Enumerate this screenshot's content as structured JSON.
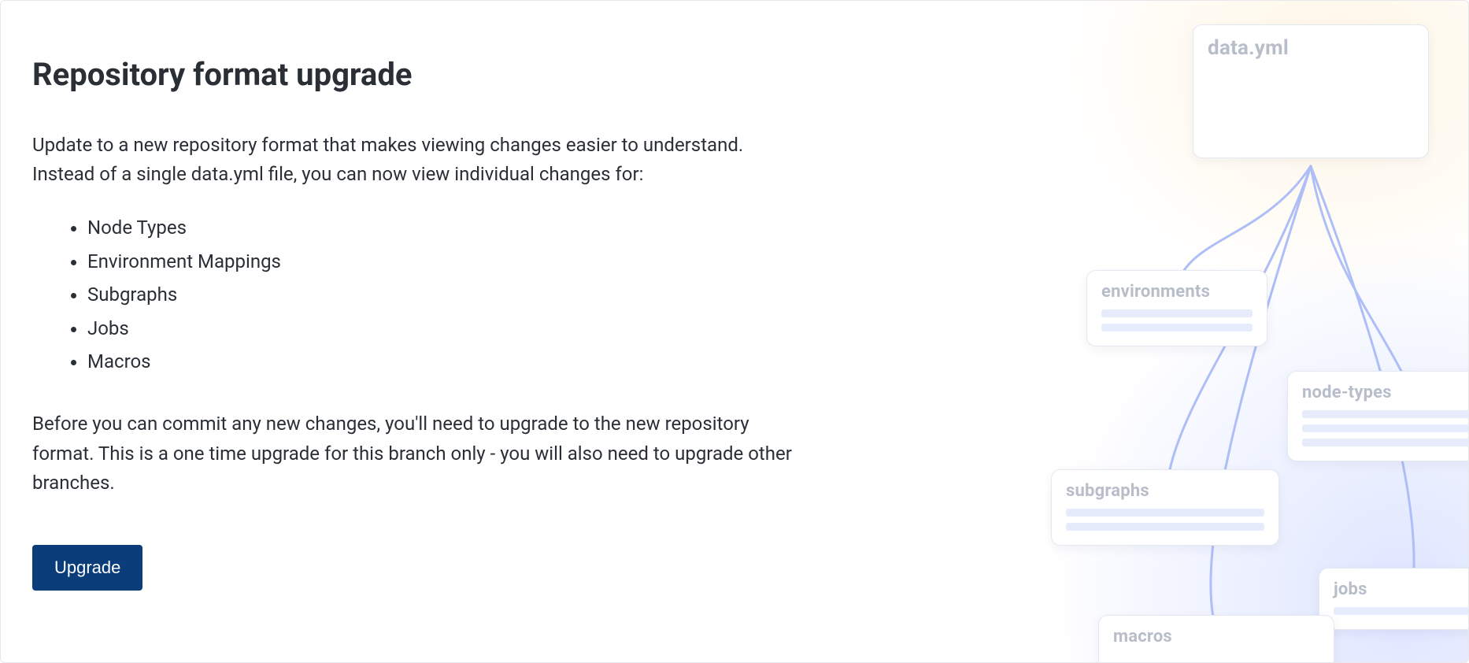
{
  "title": "Repository format upgrade",
  "intro": "Update to a new repository format that makes viewing changes easier to understand. Instead of a single data.yml file, you can now view individual changes for:",
  "bullets": [
    "Node Types",
    "Environment Mappings",
    "Subgraphs",
    "Jobs",
    "Macros"
  ],
  "note": "Before you can commit any new changes, you'll need to upgrade to the new repository format. This is a one time upgrade for this branch only - you will also need to upgrade other branches.",
  "upgrade_button": "Upgrade",
  "illustration": {
    "cards": {
      "datayml": "data.yml",
      "environments": "environments",
      "nodetypes": "node-types",
      "subgraphs": "subgraphs",
      "jobs": "jobs",
      "macros": "macros"
    }
  }
}
